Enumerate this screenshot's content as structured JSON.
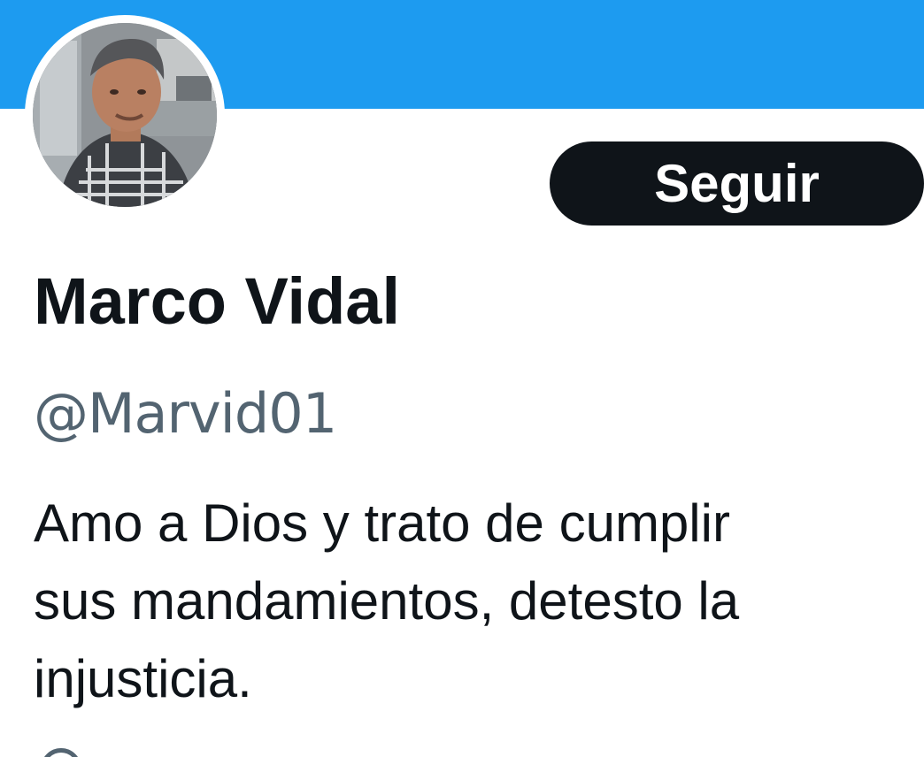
{
  "header": {
    "banner_color": "#1d9bf0"
  },
  "profile": {
    "display_name": "Marco Vidal",
    "handle": "@Marvid01",
    "follow_label": "Seguir",
    "bio_lines": [
      "Amo a Dios y trato de cumplir",
      "sus mandamientos, detesto la",
      "injusticia."
    ]
  },
  "colors": {
    "text_primary": "#0f1419",
    "text_secondary": "#536471",
    "button_background": "#0f1419"
  },
  "icons": {
    "partial_meta_icon": "location-icon"
  }
}
